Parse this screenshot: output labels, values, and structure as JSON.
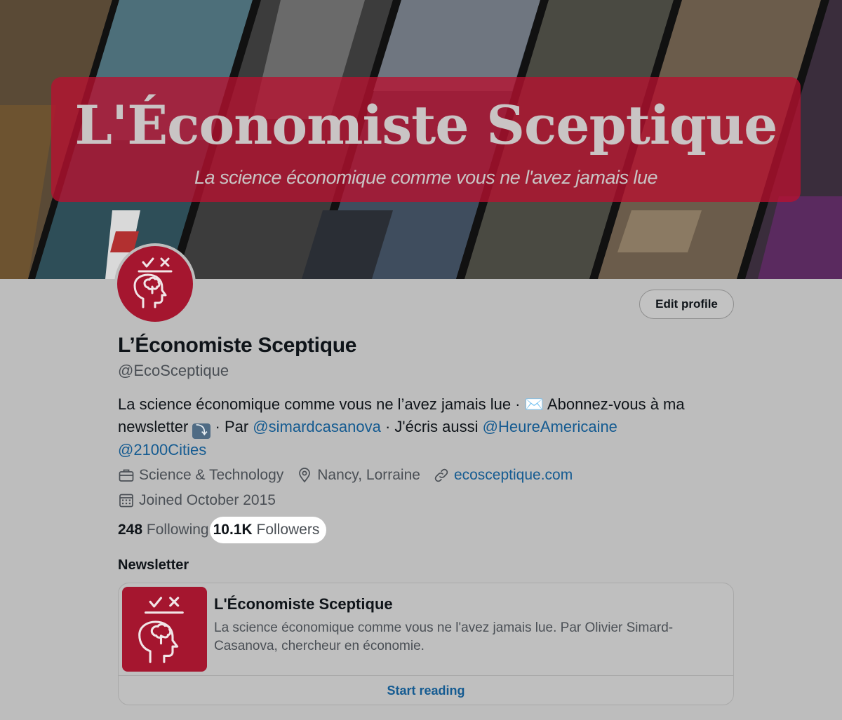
{
  "banner": {
    "title": "L'Économiste Sceptique",
    "subtitle": "La science économique comme vous ne l'avez jamais lue"
  },
  "profile": {
    "edit_label": "Edit profile",
    "display_name": "L’Économiste Sceptique",
    "handle": "@EcoSceptique",
    "bio": {
      "part1": "La science économique comme vous ne l’avez jamais lue · ",
      "envelope_emoji": "✉️",
      "part2": " Abonnez-vous à ma newsletter ",
      "arrow_emoji": "⤵",
      "part3": " · Par ",
      "mention1": "@simardcasanova",
      "part4": " · J'écris aussi ",
      "mention2": "@HeureAmericaine",
      "mention3": "@2100Cities"
    },
    "category": "Science & Technology",
    "location": "Nancy, Lorraine",
    "website": "ecosceptique.com",
    "joined": "Joined October 2015",
    "following_count": "248",
    "following_label": "Following",
    "followers_count": "10.1K",
    "followers_label": "Followers"
  },
  "newsletter": {
    "heading": "Newsletter",
    "title": "L'Économiste Sceptique",
    "description": "La science économique comme vous ne l'avez jamais lue. Par Olivier Simard-Casanova, chercheur en économie.",
    "cta": "Start reading"
  },
  "icons": {
    "category": "briefcase-icon",
    "location": "location-pin-icon",
    "website": "link-icon",
    "joined": "calendar-icon"
  },
  "colors": {
    "brand_red": "#a5162f",
    "link_blue": "#155b91",
    "page_bg": "#bdbdbd"
  }
}
